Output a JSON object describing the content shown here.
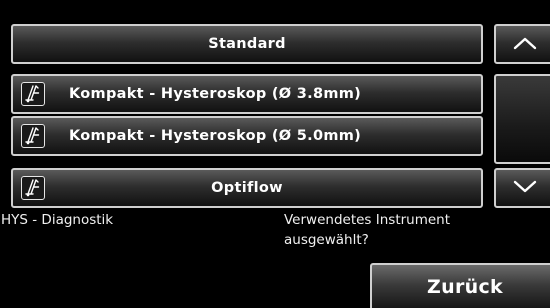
{
  "instruments": [
    {
      "label": "Standard",
      "icon": null
    },
    {
      "label": "Kompakt - Hysteroskop (Ø 3.8mm)",
      "icon": "hysteroscope-icon"
    },
    {
      "label": "Kompakt - Hysteroskop (Ø 5.0mm)",
      "icon": "hysteroscope-icon"
    },
    {
      "label": "Optiflow",
      "icon": "hysteroscope-icon"
    }
  ],
  "scroll": {
    "up_icon": "chevron-up-icon",
    "down_icon": "chevron-down-icon"
  },
  "status": {
    "mode": "HYS - Diagnostik",
    "question_line1": "Verwendetes Instrument",
    "question_line2": "ausgewählt?"
  },
  "back_button": {
    "label": "Zurück"
  },
  "colors": {
    "background": "#000000",
    "button_border": "#cfcfcf",
    "text": "#ffffff"
  }
}
